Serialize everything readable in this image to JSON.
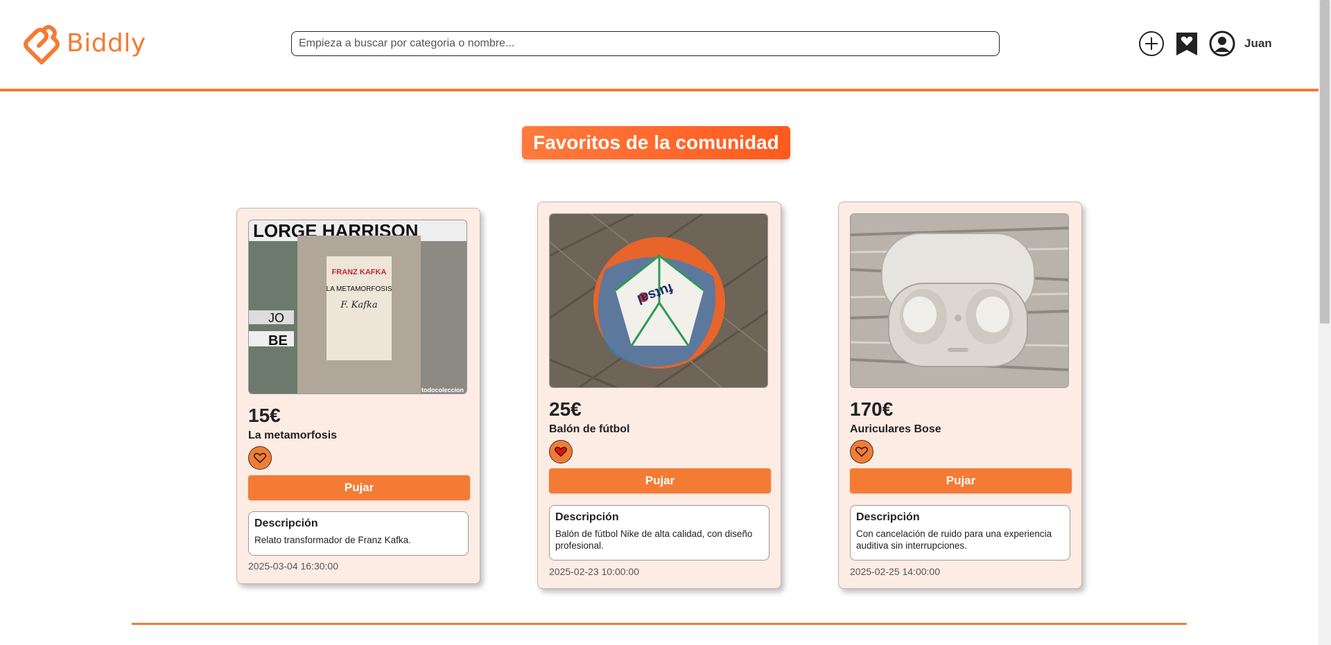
{
  "app": {
    "name": "Biddly",
    "brand_color": "#f47b34"
  },
  "header": {
    "search": {
      "placeholder": "Empieza a buscar por categoria o nombre...",
      "value": ""
    },
    "icons": [
      "plus-circle-icon",
      "bookmark-heart-icon",
      "user-avatar-icon"
    ],
    "username": "Juan"
  },
  "section": {
    "title": "Favoritos de la comunidad"
  },
  "cards": [
    {
      "price": "15€",
      "name": "La metamorfosis",
      "favorited": false,
      "bid_label": "Pujar",
      "description_title": "Descripción",
      "description": "Relato transformador de Franz Kafka.",
      "date": "2025-03-04 16:30:00",
      "image": {
        "book_author": "FRANZ KAFKA",
        "book_title": "LA METAMORFOSIS",
        "signature": "F. Kafka",
        "watermark": "todocoleccion"
      }
    },
    {
      "price": "25€",
      "name": "Balón de fútbol",
      "favorited": true,
      "bid_label": "Pujar",
      "description_title": "Descripción",
      "description": "Balón de fútbol Nike de alta calidad, con diseño profesional.",
      "date": "2025-02-23 10:00:00"
    },
    {
      "price": "170€",
      "name": "Auriculares Bose",
      "favorited": false,
      "bid_label": "Pujar",
      "description_title": "Descripción",
      "description": "Con cancelación de ruido para una experiencia auditiva sin interrupciones.",
      "date": "2025-02-25 14:00:00"
    }
  ]
}
